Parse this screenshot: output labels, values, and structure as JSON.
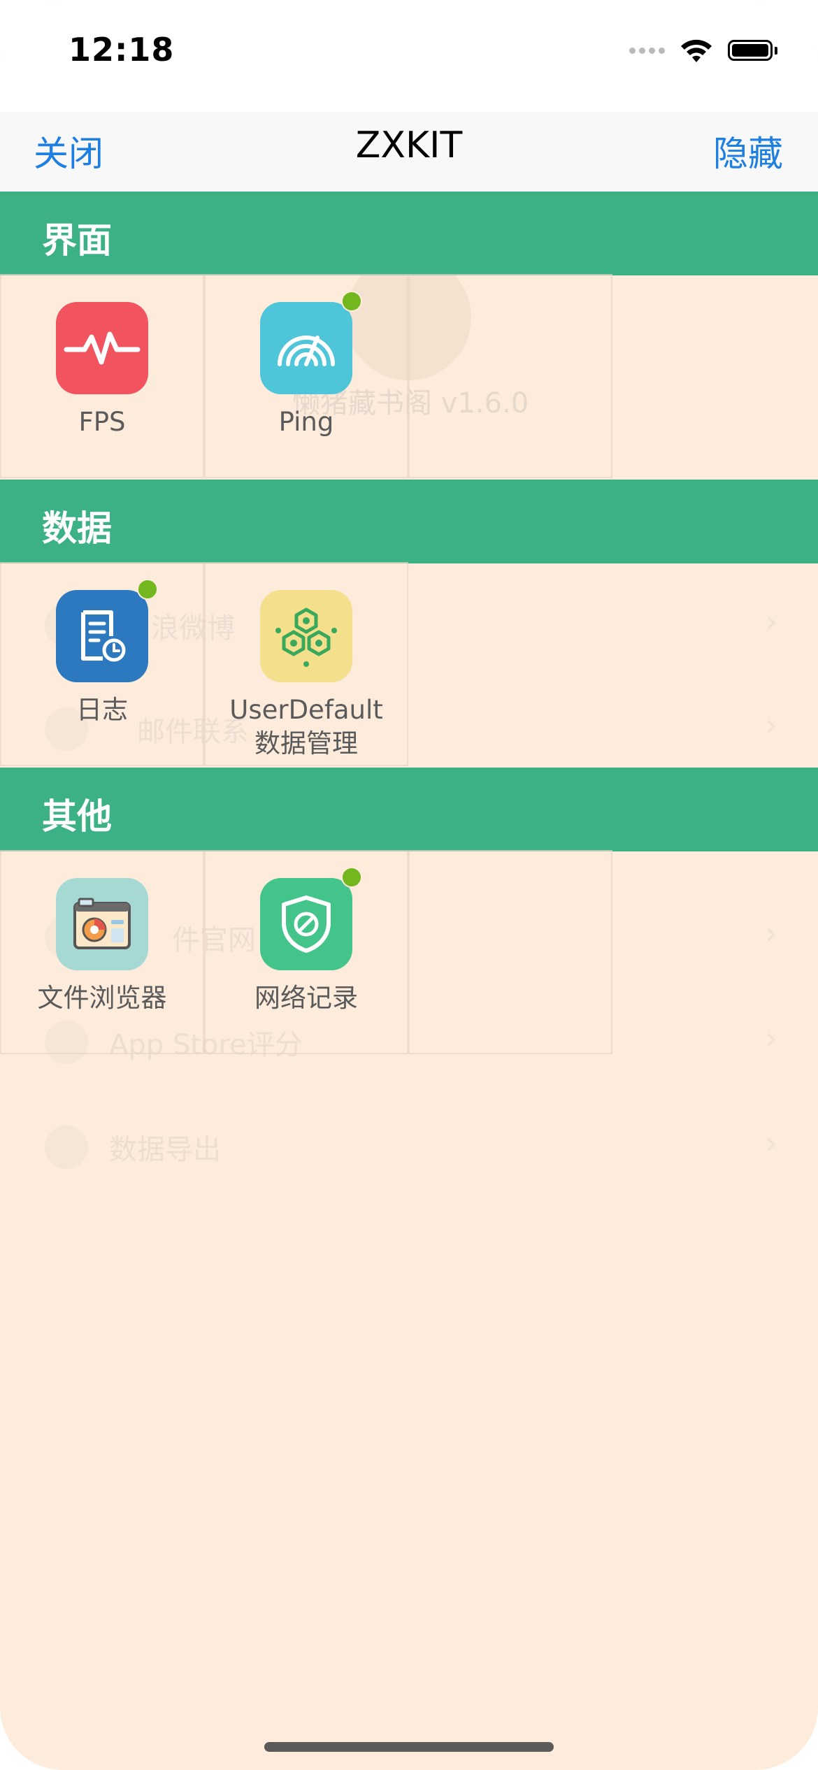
{
  "status_bar": {
    "time": "12:18"
  },
  "nav": {
    "close_label": "关闭",
    "title": "ZXKIT",
    "hide_label": "隐藏"
  },
  "background": {
    "version": "懒猪藏书阁 v1.6.0",
    "rows": [
      "浪微博",
      "邮件联系",
      "件官网",
      "App Store评分",
      "数据导出"
    ]
  },
  "sections": [
    {
      "title": "界面",
      "tiles": [
        {
          "label": "FPS",
          "icon": "pulse-icon",
          "color": "#f2545f",
          "badge": false
        },
        {
          "label": "Ping",
          "icon": "speedometer-icon",
          "color": "#4ec5d8",
          "badge": true
        }
      ]
    },
    {
      "title": "数据",
      "tiles": [
        {
          "label": "日志",
          "icon": "document-clock-icon",
          "color": "#2d79bf",
          "badge": true
        },
        {
          "label": "UserDefault",
          "label2": "数据管理",
          "icon": "hexagon-network-icon",
          "color": "#f4e08c",
          "badge": false
        }
      ]
    },
    {
      "title": "其他",
      "tiles": [
        {
          "label": "文件浏览器",
          "icon": "file-browser-icon",
          "color": "#a6d9d4",
          "badge": false
        },
        {
          "label": "网络记录",
          "icon": "shield-icon",
          "color": "#43c48a",
          "badge": true
        }
      ]
    }
  ]
}
